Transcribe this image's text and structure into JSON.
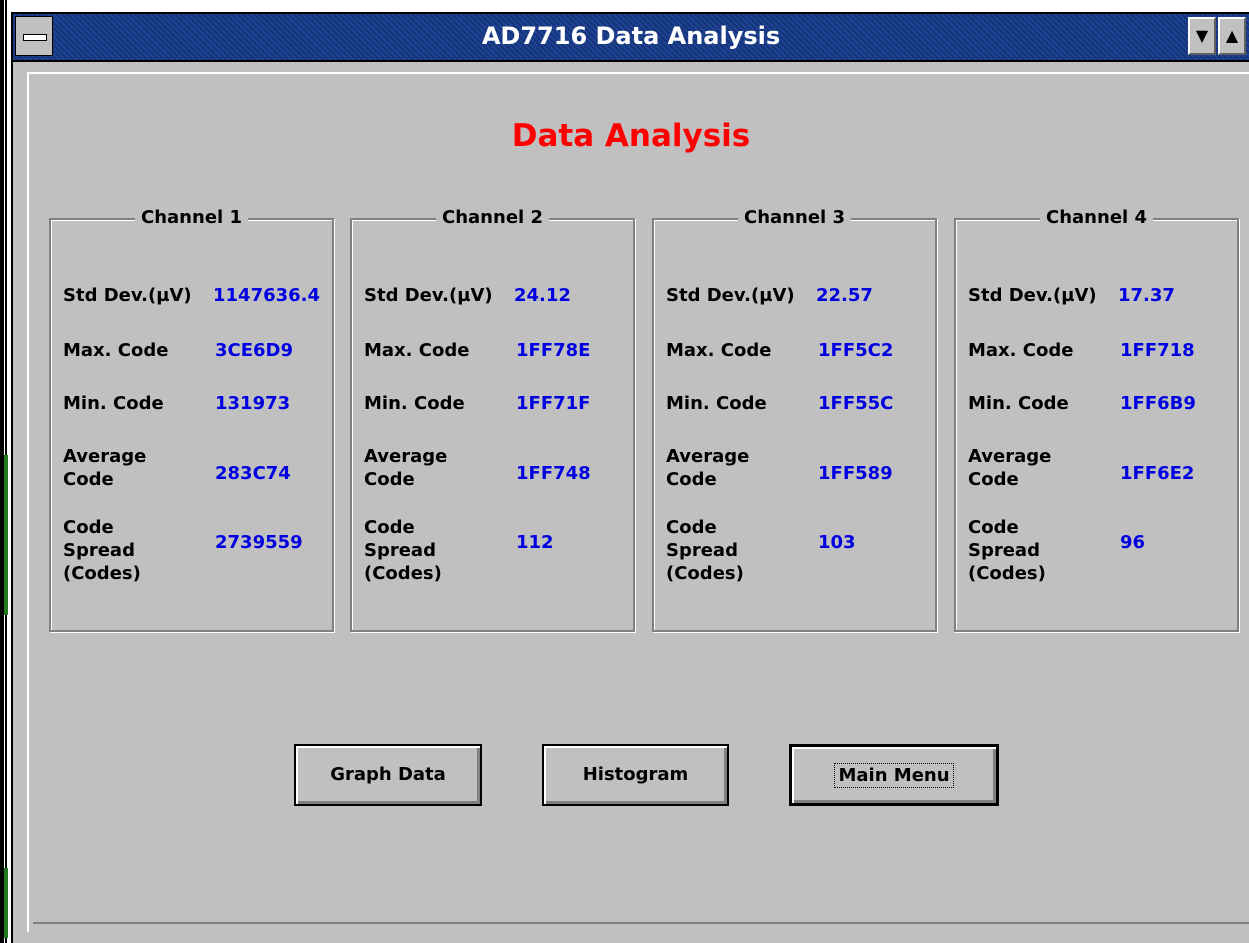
{
  "window": {
    "title": "AD7716 Data Analysis",
    "min_glyph": "▼",
    "max_glyph": "▲"
  },
  "heading": "Data Analysis",
  "row_labels": {
    "std_dev": "Std Dev.(µV)",
    "max_code": "Max. Code",
    "min_code": "Min. Code",
    "avg_line1": "Average",
    "avg_line2": "Code",
    "spread_line1": "Code",
    "spread_line2": "Spread",
    "spread_line3": "(Codes)"
  },
  "channels": [
    {
      "name": "Channel 1",
      "std_dev": "1147636.4",
      "max_code": "3CE6D9",
      "min_code": "131973",
      "avg_code": "283C74",
      "spread": "2739559"
    },
    {
      "name": "Channel 2",
      "std_dev": "24.12",
      "max_code": "1FF78E",
      "min_code": "1FF71F",
      "avg_code": "1FF748",
      "spread": "112"
    },
    {
      "name": "Channel 3",
      "std_dev": "22.57",
      "max_code": "1FF5C2",
      "min_code": "1FF55C",
      "avg_code": "1FF589",
      "spread": "103"
    },
    {
      "name": "Channel 4",
      "std_dev": "17.37",
      "max_code": "1FF718",
      "min_code": "1FF6B9",
      "avg_code": "1FF6E2",
      "spread": "96"
    }
  ],
  "buttons": {
    "graph_data": "Graph Data",
    "histogram": "Histogram",
    "main_menu": "Main Menu"
  },
  "colors": {
    "title_bar": "#1a3d8a",
    "heading": "#ff0000",
    "value": "#0000e0",
    "face": "#c0c0c0"
  }
}
